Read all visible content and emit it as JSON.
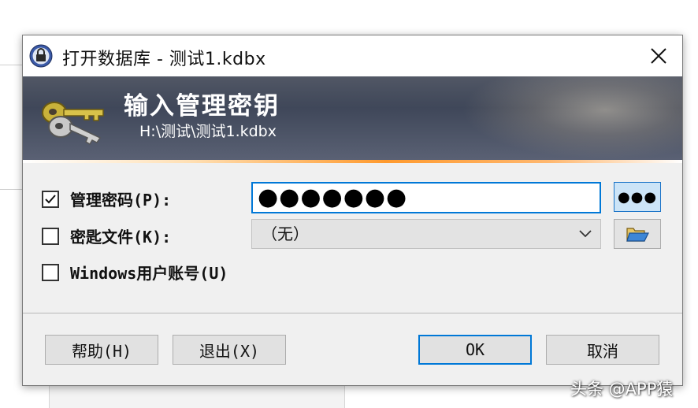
{
  "window": {
    "title": "打开数据库 - 测试1.kdbx",
    "close_icon": "close-icon"
  },
  "banner": {
    "title": "输入管理密钥",
    "path": "H:\\测试\\测试1.kdbx",
    "icon": "key-icon"
  },
  "master_password": {
    "checked": true,
    "label": "管理密码(P):",
    "value": "●●●●●●●",
    "reveal_button_label": "●●●"
  },
  "key_file": {
    "checked": false,
    "label": "密匙文件(K):",
    "selected": "（无）",
    "browse_icon": "folder-open-icon"
  },
  "windows_account": {
    "checked": false,
    "label": "Windows用户账号(U)"
  },
  "buttons": {
    "help": "帮助(H)",
    "exit": "退出(X)",
    "ok": "OK",
    "cancel": "取消"
  },
  "watermark": "头条 @APP猿",
  "colors": {
    "accent": "#0078d7",
    "banner_dark": "#2c3344",
    "banner_stripe": "#ff9a2e"
  }
}
